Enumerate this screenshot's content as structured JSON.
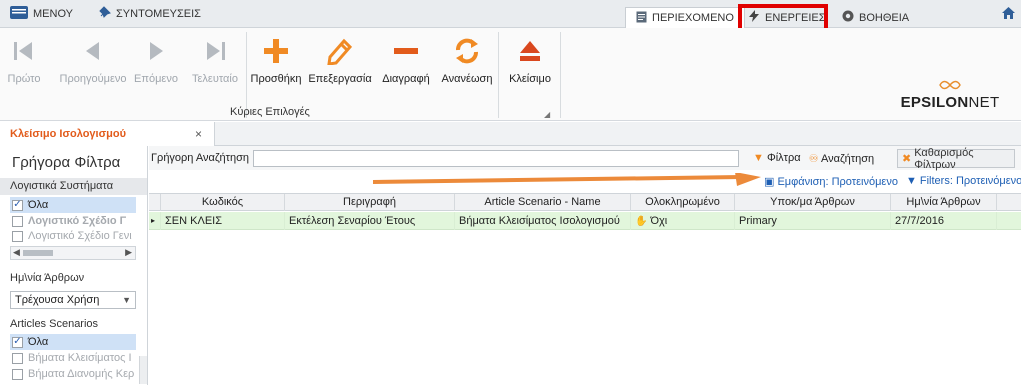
{
  "topbar": {
    "menu_label": "ΜΕΝΟΥ",
    "shortcuts_label": "ΣΥΝΤΟΜΕΥΣΕΙΣ",
    "tabs": [
      {
        "label": "ΠΕΡΙΕΧΟΜΕΝΟ"
      },
      {
        "label": "ΕΝΕΡΓΕΙΕΣ"
      },
      {
        "label": "ΒΟΗΘΕΙΑ"
      }
    ]
  },
  "ribbon": {
    "nav_buttons": [
      {
        "label": "Πρώτο"
      },
      {
        "label": "Προηγούμενο"
      },
      {
        "label": "Επόμενο"
      },
      {
        "label": "Τελευταίο"
      }
    ],
    "action_buttons": [
      {
        "label": "Προσθήκη"
      },
      {
        "label": "Επεξεργασία"
      },
      {
        "label": "Διαγραφή"
      },
      {
        "label": "Ανανέωση"
      },
      {
        "label": "Κλείσιμο"
      }
    ],
    "group_label": "Κύριες Επιλογές",
    "brand_bold": "EPSILON",
    "brand_light": "NET"
  },
  "document_tab": {
    "title": "Κλείσιμο Ισολογισμού",
    "close": "×"
  },
  "left_panel": {
    "title": "Γρήγορα Φίλτρα",
    "section_systems": "Λογιστικά Συστήματα",
    "systems_items": [
      {
        "label": "Όλα"
      },
      {
        "label": "Λογιστικό Σχέδιο Γ"
      },
      {
        "label": "Λογιστικό Σχέδιο Γενι"
      }
    ],
    "section_date": "Ημ\\νία Άρθρων",
    "date_value": "Τρέχουσα Χρήση",
    "section_scenarios": "Articles Scenarios",
    "scenario_items": [
      {
        "label": "Όλα"
      },
      {
        "label": "Βήματα Κλεισίματος Ι"
      },
      {
        "label": "Βήματα Διανομής Κερ"
      }
    ]
  },
  "search": {
    "label": "Γρήγορη Αναζήτηση",
    "value": "",
    "filters_link": "Φίλτρα",
    "search_link": "Αναζήτηση",
    "clear_button": "Καθαρισμός Φίλτρων"
  },
  "view": {
    "display_link": "Εμφάνιση: Προτεινόμενο",
    "filters_link": "Filters: Προτεινόμενο"
  },
  "grid": {
    "columns": [
      "Κωδικός",
      "Περιγραφή",
      "Article Scenario - Name",
      "Ολοκληρωμένο",
      "Υποκ/μα Άρθρων",
      "Ημ\\νία Άρθρων"
    ],
    "rows": [
      [
        "ΣΕΝ ΚΛΕΙΣ",
        "Εκτέλεση Σεναρίου Έτους",
        "Βήματα Κλεισίματος Ισολογισμού",
        "Όχι",
        "Primary",
        "27/7/2016"
      ]
    ]
  },
  "colors": {
    "accent_orange": "#f08a24",
    "highlight_red": "#e00000",
    "row_green": "#e2f6dc",
    "tab_title_orange": "#e25b1b",
    "link_blue": "#1e5fb4"
  }
}
